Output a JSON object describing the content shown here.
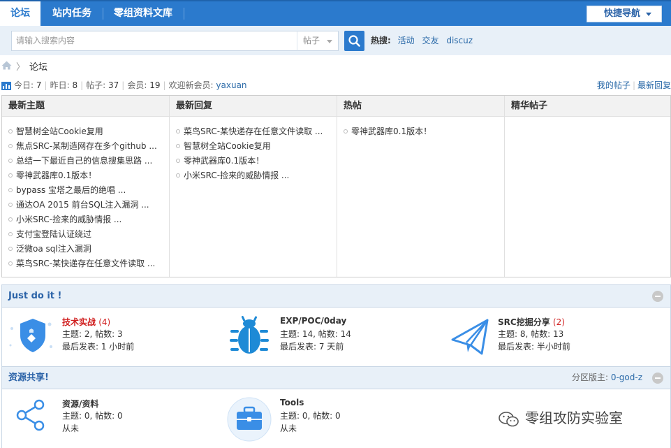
{
  "nav": {
    "tabs": [
      "论坛",
      "站内任务",
      "零组资料文库"
    ],
    "quick_nav": "快捷导航"
  },
  "search": {
    "placeholder": "请输入搜索内容",
    "type": "帖子",
    "hot_label": "热搜:",
    "hot_tags": [
      "活动",
      "交友",
      "discuz"
    ]
  },
  "breadcrumb": {
    "current": "论坛"
  },
  "stats": {
    "today_label": "今日:",
    "today": "7",
    "yesterday_label": "昨日:",
    "yesterday": "8",
    "posts_label": "帖子:",
    "posts": "37",
    "members_label": "会员:",
    "members": "19",
    "newest_label": "欢迎新会员:",
    "newest_member": "yaxuan"
  },
  "my_links": {
    "my_posts": "我的帖子",
    "latest_replies": "最新回复"
  },
  "columns": [
    {
      "title": "最新主题",
      "items": [
        "智慧树全站Cookie复用",
        "焦点SRC-某制造网存在多个github ...",
        "总结一下最近自己的信息搜集思路 ...",
        "零神武器库0.1版本！",
        "bypass 宝塔之最后的绝唱 ...",
        "通达OA 2015 前台SQL注入漏洞 ...",
        "小米SRC-捡来的威胁情报 ...",
        "支付宝登陆认证绕过",
        "泛微oa sql注入漏洞",
        "菜鸟SRC-某快递存在任意文件读取 ..."
      ]
    },
    {
      "title": "最新回复",
      "items": [
        "菜鸟SRC-某快递存在任意文件读取 ...",
        "智慧树全站Cookie复用",
        "零神武器库0.1版本！",
        "小米SRC-捡来的威胁情报 ..."
      ]
    },
    {
      "title": "热帖",
      "items": [
        "零神武器库0.1版本！"
      ]
    },
    {
      "title": "精华帖子",
      "items": []
    }
  ],
  "sections": [
    {
      "title": "Just do it !",
      "forums": [
        {
          "name": "技术实战",
          "count": "(4)",
          "topics": "主题: 2, 帖数: 3",
          "last": "最后发表: 1 小时前",
          "icon": "shield-icon"
        },
        {
          "name": "EXP/POC/0day",
          "count": "",
          "topics": "主题: 14, 帖数: 14",
          "last": "最后发表: 7 天前",
          "icon": "bug-icon"
        },
        {
          "name": "SRC挖掘分享",
          "count": "(2)",
          "topics": "主题: 8, 帖数: 13",
          "last": "最后发表: 半小时前",
          "icon": "paper-plane-icon"
        }
      ]
    },
    {
      "title": "资源共享!",
      "moderator_label": "分区版主:",
      "moderator": "0-god-z",
      "forums": [
        {
          "name": "资源/资料",
          "topics": "主题: 0, 帖数: 0",
          "last": "从未",
          "icon": "share-icon"
        },
        {
          "name": "Tools",
          "topics": "主题: 0, 帖数: 0",
          "last": "从未",
          "icon": "toolbox-icon"
        }
      ]
    }
  ],
  "watermark": "零组攻防实验室",
  "colors": {
    "primary": "#2b7acd",
    "link": "#2b6aa8",
    "highlight": "#d01f1f",
    "section_bg": "#e8f0f8"
  }
}
